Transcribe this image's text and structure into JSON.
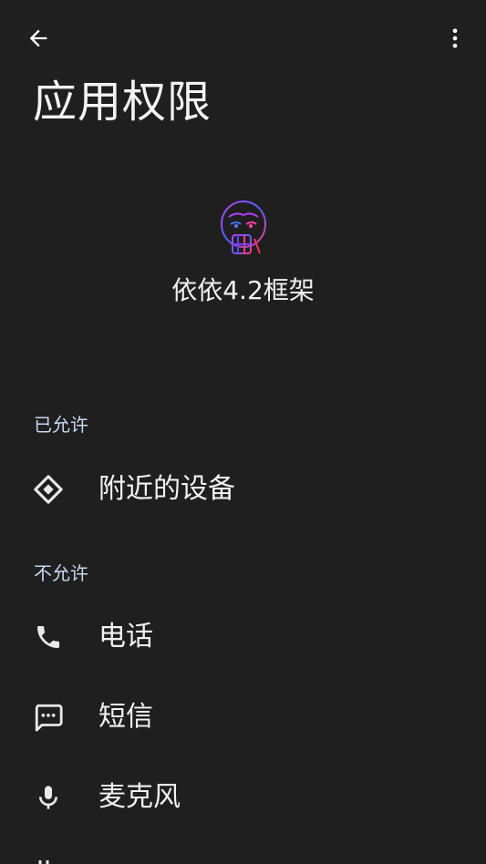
{
  "page": {
    "title": "应用权限"
  },
  "app": {
    "name": "依依4.2框架",
    "icon": "doodle-face-app-icon"
  },
  "sections": {
    "allowed": {
      "label": "已允许",
      "items": [
        {
          "label": "附近的设备",
          "icon": "nearby-devices-icon"
        }
      ]
    },
    "denied": {
      "label": "不允许",
      "items": [
        {
          "label": "电话",
          "icon": "phone-icon"
        },
        {
          "label": "短信",
          "icon": "sms-icon"
        },
        {
          "label": "麦克风",
          "icon": "microphone-icon"
        }
      ]
    }
  },
  "colors": {
    "background": "#1f1f1f",
    "text": "#f3f3f3",
    "section_label": "#c8d8f2",
    "icon": "#e8e8e8"
  }
}
